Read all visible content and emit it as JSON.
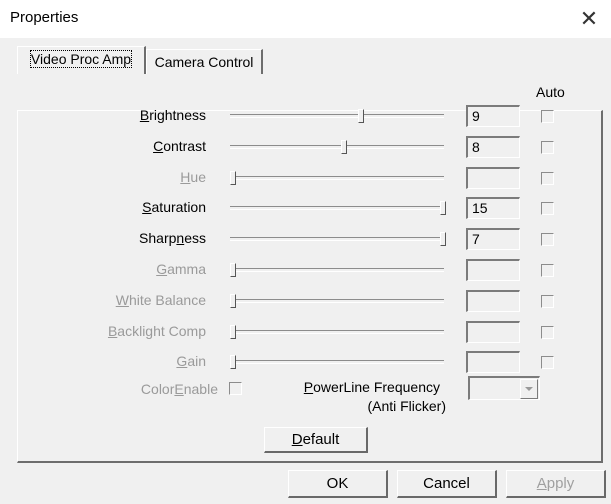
{
  "window": {
    "title": "Properties",
    "close_glyph": "✕"
  },
  "tabs": [
    {
      "label": "Video Proc Amp",
      "active": true
    },
    {
      "label": "Camera Control",
      "active": false
    }
  ],
  "auto_header": "Auto",
  "rows": [
    {
      "label_pre": "",
      "label_u": "B",
      "label_post": "rightness",
      "value": "9",
      "enabled": true,
      "level": 0.61
    },
    {
      "label_pre": "",
      "label_u": "C",
      "label_post": "ontrast",
      "value": "8",
      "enabled": true,
      "level": 0.53
    },
    {
      "label_pre": "",
      "label_u": "H",
      "label_post": "ue",
      "value": "",
      "enabled": false,
      "level": 0.0
    },
    {
      "label_pre": "",
      "label_u": "S",
      "label_post": "aturation",
      "value": "15",
      "enabled": true,
      "level": 1.0
    },
    {
      "label_pre": "Sharp",
      "label_u": "n",
      "label_post": "ess",
      "value": "7",
      "enabled": true,
      "level": 1.0
    },
    {
      "label_pre": "",
      "label_u": "G",
      "label_post": "amma",
      "value": "",
      "enabled": false,
      "level": 0.0
    },
    {
      "label_pre": "",
      "label_u": "W",
      "label_post": "hite Balance",
      "value": "",
      "enabled": false,
      "level": 0.0
    },
    {
      "label_pre": "",
      "label_u": "B",
      "label_post": "acklight Comp",
      "value": "",
      "enabled": false,
      "level": 0.0
    },
    {
      "label_pre": "",
      "label_u": "G",
      "label_post": "ain",
      "value": "",
      "enabled": false,
      "level": 0.0
    }
  ],
  "color_enable": {
    "pre": "Color",
    "u": "E",
    "post": "nable"
  },
  "powerline": {
    "line1_u": "P",
    "line1_post": "owerLine Frequency",
    "line2": "(Anti Flicker)"
  },
  "buttons": {
    "default_u": "D",
    "default_post": "efault",
    "ok": "OK",
    "cancel": "Cancel",
    "apply_u": "A",
    "apply_post": "pply"
  }
}
